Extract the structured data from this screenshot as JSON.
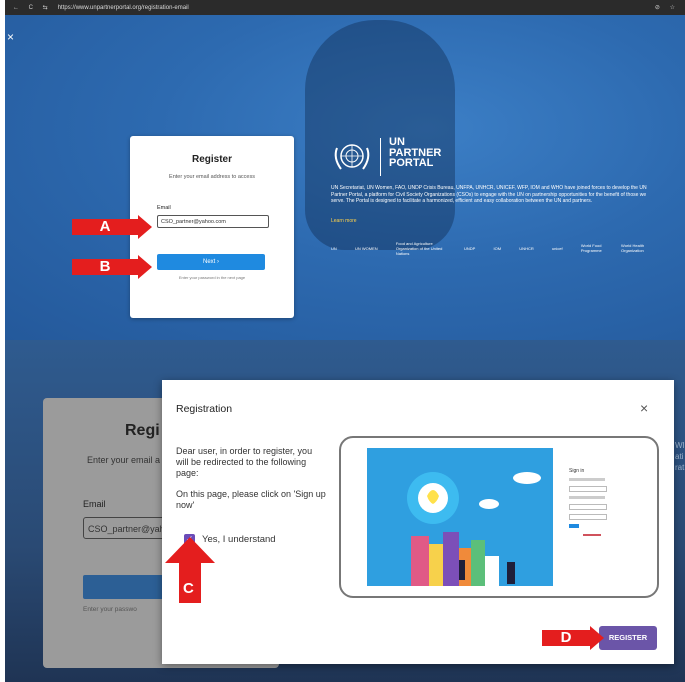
{
  "browser": {
    "nav_icons": "← C ⇆",
    "url": "https://www.unpartnerportal.org/registration-email",
    "right_icons": "⊘ ☆"
  },
  "top": {
    "close": "×",
    "register_card": {
      "title": "Register",
      "subtitle": "Enter your email address to access",
      "email_label": "Email",
      "email_value": "CSO_partner@yahoo.com",
      "next_label": "Next  ›",
      "hint": "Enter your password in the next page"
    },
    "portal": {
      "title_line1": "UN",
      "title_line2": "PARTNER",
      "title_line3": "PORTAL",
      "description": "UN Secretariat, UN Women, FAO, UNDP Crisis Bureau, UNFPA, UNHCR, UNICEF, WFP, IOM and WHO have joined forces to develop the UN Partner Portal, a platform for Civil Society Organizations (CSOs) to engage with the UN on partnership opportunities for the benefit of those we serve. The Portal is designed to facilitate a harmonized, efficient and easy collaboration between the UN and partners.",
      "learn_more": "Learn more",
      "partners": [
        "UN",
        "UN WOMEN",
        "Food and Agriculture Organization of the United Nations",
        "UNDP",
        "IOM",
        "UNHCR",
        "unicef",
        "World Food Programme",
        "World Health Organization"
      ]
    }
  },
  "bottom": {
    "dim_card": {
      "title": "Regi",
      "subtitle": "Enter your email a",
      "email_label": "Email",
      "email_value": "CSO_partner@yah",
      "next_label": "Next",
      "hint": "Enter your passwo"
    },
    "right_fragment": [
      "WI",
      "ati",
      "rat"
    ],
    "dialog": {
      "title": "Registration",
      "close": "×",
      "para1": "Dear user, in order to register, you will be redirected to the following page:",
      "para2": "On this page, please click on 'Sign up now'",
      "checkbox_label": "Yes, I understand",
      "checkbox_checked": true,
      "register_label": "REGISTER",
      "preview_signin": "Sign in"
    }
  },
  "annotations": {
    "labels": [
      "A",
      "B",
      "C",
      "D"
    ],
    "color": "#e41e1e"
  },
  "colors": {
    "hero_blue": "#2f6fb8",
    "next_blue": "#1f8ae0",
    "register_purple": "#6b55a8",
    "learn_more": "#ffd24a"
  }
}
